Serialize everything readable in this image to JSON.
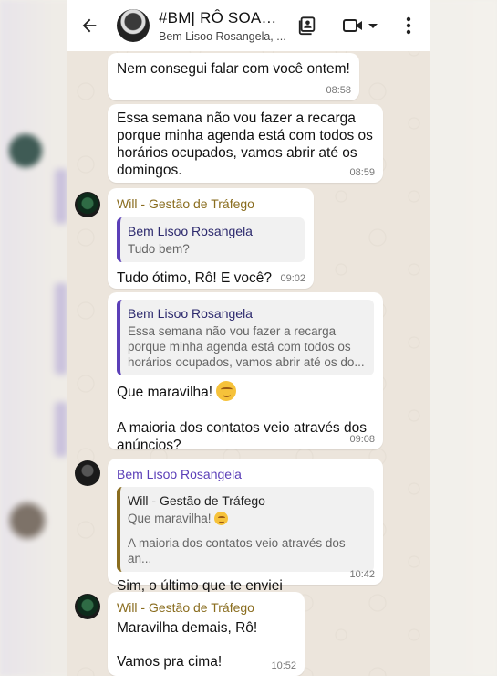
{
  "header": {
    "title": "#BM| RÔ SOARE...",
    "subtitle": "Bem Lisoo Rosangela, ..."
  },
  "messages": [
    {
      "text": "Nem consegui falar com você ontem!",
      "time": "08:58"
    },
    {
      "text": "Essa semana não vou fazer a recarga porque minha agenda está com todos os horários ocupados, vamos abrir até os domingos.",
      "time": "08:59"
    },
    {
      "sender": "Will - Gestão de Tráfego",
      "quote_author": "Bem Lisoo Rosangela",
      "quote_text": "Tudo bem?",
      "text": "Tudo ótimo, Rô! E você?",
      "time": "09:02"
    },
    {
      "quote_author": "Bem Lisoo Rosangela",
      "quote_text": "Essa semana não vou fazer a recarga porque minha agenda está com todos os horários ocupados, vamos abrir até os  do...",
      "text": "Que maravilha!",
      "text2": "A maioria dos contatos veio através dos anúncios?",
      "time": "09:08"
    },
    {
      "sender": "Bem Lisoo Rosangela",
      "quote_author": "Will - Gestão de Tráfego",
      "quote_text": "Que maravilha!",
      "quote_text2": "A maioria dos contatos veio através dos an...",
      "text": "Sim, o último que te enviei",
      "time": "10:42"
    },
    {
      "sender": "Will - Gestão de Tráfego",
      "text": "Maravilha demais, Rô!",
      "text2": "Vamos pra cima!",
      "time": "10:52"
    }
  ],
  "icons": {
    "back": "arrow-left-icon",
    "contact_card": "contact-card-icon",
    "video": "video-camera-icon",
    "menu": "more-vertical-icon",
    "emoji": "smiling-face-emoji"
  },
  "colors": {
    "will_name": "#8a6d1f",
    "bem_name": "#5b3fb8",
    "quote_bar": "#5b3fb8",
    "chat_bg": "#ece5dc"
  }
}
